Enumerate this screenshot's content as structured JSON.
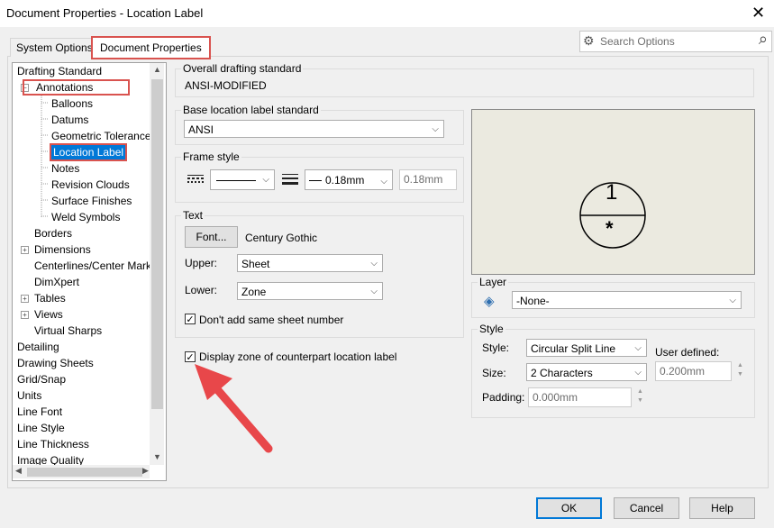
{
  "window": {
    "title": "Document Properties - Location Label",
    "close_glyph": "✕"
  },
  "tabs": [
    {
      "label": "System Options",
      "active": false
    },
    {
      "label": "Document Properties",
      "active": true
    }
  ],
  "search": {
    "placeholder": "Search Options"
  },
  "tree": {
    "items": [
      {
        "label": "Drafting Standard"
      },
      {
        "label": "Annotations"
      },
      {
        "label": "Balloons"
      },
      {
        "label": "Datums"
      },
      {
        "label": "Geometric Tolerance"
      },
      {
        "label": "Location Label"
      },
      {
        "label": "Notes"
      },
      {
        "label": "Revision Clouds"
      },
      {
        "label": "Surface Finishes"
      },
      {
        "label": "Weld Symbols"
      },
      {
        "label": "Borders"
      },
      {
        "label": "Dimensions"
      },
      {
        "label": "Centerlines/Center Mark"
      },
      {
        "label": "DimXpert"
      },
      {
        "label": "Tables"
      },
      {
        "label": "Views"
      },
      {
        "label": "Virtual Sharps"
      },
      {
        "label": "Detailing"
      },
      {
        "label": "Drawing Sheets"
      },
      {
        "label": "Grid/Snap"
      },
      {
        "label": "Units"
      },
      {
        "label": "Line Font"
      },
      {
        "label": "Line Style"
      },
      {
        "label": "Line Thickness"
      },
      {
        "label": "Image Quality"
      }
    ]
  },
  "overall": {
    "label": "Overall drafting standard",
    "value": "ANSI-MODIFIED"
  },
  "base": {
    "label": "Base location label standard",
    "value": "ANSI"
  },
  "frame": {
    "label": "Frame style",
    "thickness": "0.18mm",
    "custom": "0.18mm"
  },
  "text": {
    "label": "Text",
    "font_button": "Font...",
    "font_name": "Century Gothic",
    "upper_label": "Upper:",
    "upper_value": "Sheet",
    "lower_label": "Lower:",
    "lower_value": "Zone",
    "no_sheet_label": "Don't add same sheet number",
    "no_sheet_checked": true
  },
  "display_zone": {
    "label": "Display zone of counterpart location label",
    "checked": true
  },
  "preview": {
    "upper": "1",
    "lower": "*"
  },
  "layer": {
    "label": "Layer",
    "value": "-None-"
  },
  "style": {
    "label": "Style",
    "style_label": "Style:",
    "style_value": "Circular Split Line",
    "size_label": "Size:",
    "size_value": "2 Characters",
    "user_defined_label": "User defined:",
    "user_defined_value": "0.200mm",
    "padding_label": "Padding:",
    "padding_value": "0.000mm"
  },
  "buttons": {
    "ok": "OK",
    "cancel": "Cancel",
    "help": "Help"
  },
  "colors": {
    "highlight": "#d9534f",
    "selection": "#0078d7",
    "arrow": "#e8474a"
  }
}
